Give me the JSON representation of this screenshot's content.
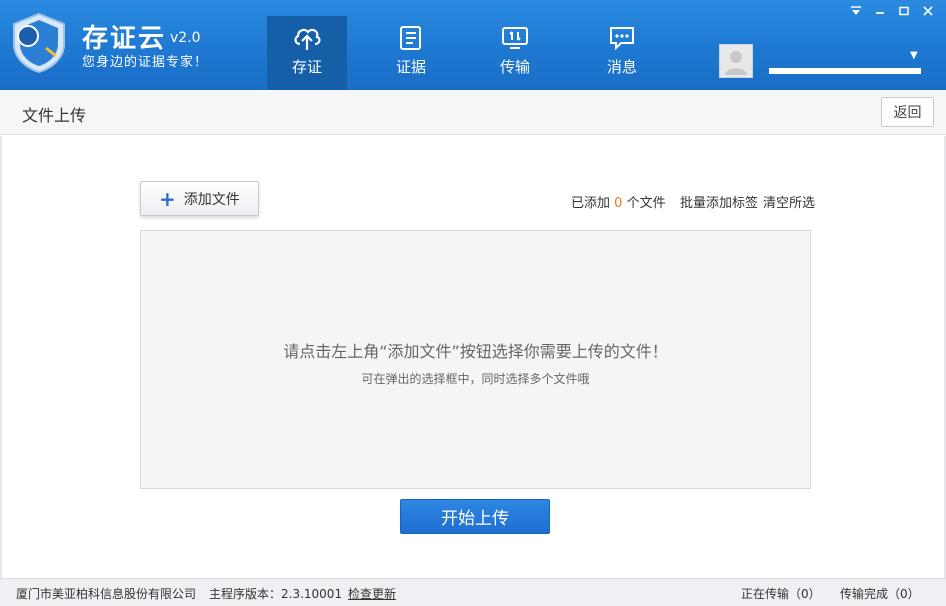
{
  "app": {
    "name": "存证云",
    "version": "v2.0",
    "slogan": "您身边的证据专家！"
  },
  "nav": {
    "items": [
      {
        "label": "存证",
        "icon": "cloud-upload-icon",
        "active": true
      },
      {
        "label": "证据",
        "icon": "document-icon",
        "active": false
      },
      {
        "label": "传输",
        "icon": "transfer-icon",
        "active": false
      },
      {
        "label": "消息",
        "icon": "message-icon",
        "active": false
      }
    ]
  },
  "window_controls": [
    "menu-icon",
    "minimize-icon",
    "maximize-icon",
    "close-icon"
  ],
  "page": {
    "title": "文件上传",
    "back_label": "返回"
  },
  "toolbar": {
    "add_file_label": "添加文件",
    "added_prefix": "已添加",
    "added_count": "0",
    "added_suffix": "个文件",
    "batch_tag_label": "批量添加标签",
    "clear_selection_label": "清空所选"
  },
  "drop_zone": {
    "hint": "请点击左上角“添加文件”按钮选择你需要上传的文件！",
    "subhint": "可在弹出的选择框中，同时选择多个文件哦"
  },
  "actions": {
    "start_upload_label": "开始上传"
  },
  "status": {
    "company": "厦门市美亚柏科信息股份有限公司",
    "version_label": "主程序版本：2.3.10001",
    "check_update_label": "检查更新",
    "transferring": "正在传输（0）",
    "transfer_done": "传输完成（0）"
  },
  "colors": {
    "header_blue": "#1e78d2",
    "active_nav": "#155fa8",
    "accent_orange": "#e87722",
    "start_button": "#2378d8"
  }
}
